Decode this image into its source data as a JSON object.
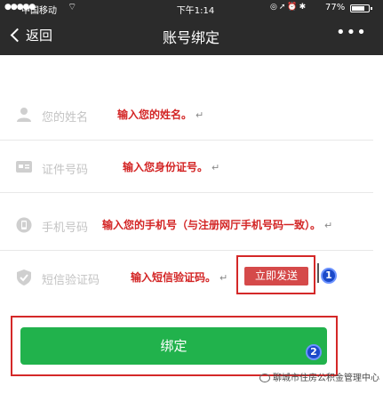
{
  "status_bar": {
    "carrier": "中国移动",
    "time": "下午1:14",
    "battery": "77%"
  },
  "nav": {
    "back_label": "返回",
    "title": "账号绑定",
    "more_label": "•••"
  },
  "form": {
    "name": {
      "label": "您的姓名",
      "hint": "输入您的姓名。"
    },
    "id_number": {
      "label": "证件号码",
      "hint": "输入您身份证号。"
    },
    "phone": {
      "label": "手机号码",
      "hint": "输入您的手机号（与注册网厅手机号码一致）。"
    },
    "sms_code": {
      "label": "短信验证码",
      "hint": "输入短信验证码。"
    },
    "return_mark": "↵"
  },
  "send_code_label": "立即发送",
  "bind_label": "绑定",
  "callouts": {
    "one": "1",
    "two": "2"
  },
  "watermark": "聊城市住房公积金管理中心"
}
